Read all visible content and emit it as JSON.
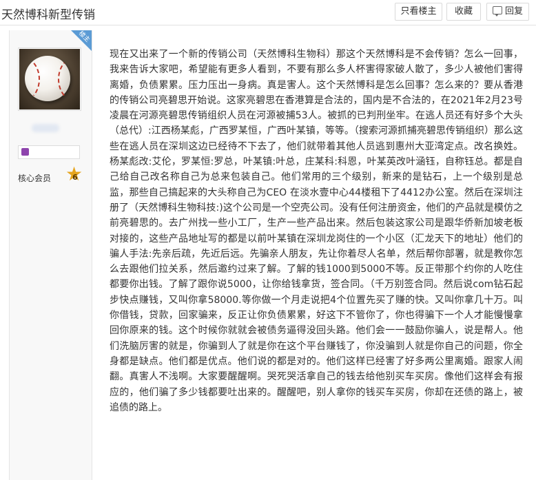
{
  "header": {
    "title": "天然博科新型传销",
    "only_op_label": "只看楼主",
    "favorite_label": "收藏",
    "reply_label": "回复"
  },
  "author": {
    "badge": "楼主",
    "level_label": "核心会员",
    "level_number": "6"
  },
  "post": {
    "content": "现在又出来了一个新的传销公司（天然博科生物科）那这个天然博科是不会传销？怎么一回事，我来告诉大家吧，希望能有更多人看到，不要有那么多人杯害得家破人散了，多少人被他们害得离婚，负债累累。压力压出一身病。真是害人。这个天然博科是怎么回事？怎么来的？要从香港的传销公司亮碧思开始说。这家亮碧思在香港算是合法的，国内是不合法的，在2021年2月23号凌晨在河源亮碧思传销组织人员在河源被捕53人。被抓的已判刑坐牢。在逃人员还有好多个大头（总代）:江西杨某彪，广西罗某恒，广西叶某镇，等等。（搜索河源抓捕亮碧思传销组织）那么这些在逃人员在深圳这边已经待不下去了，他们就带着其他人员逃到惠州大亚湾定点。改名换姓。杨某彪改:艾伦，罗某恒:罗总，叶某镇:叶总，庄某科:科恩，叶某英改叶涵钰，自称钰总。都是自己给自己改名称自己为总来包装自己。他们常用的三个级别，新来的是钻石，上一个级别是总监，那些自己搞起来的大头称自己为CEO 在淡水壹中心44楼租下了4412办公室。然后在深圳注册了（天然博科生物科技:)这个公司是一个空壳公司。没有任何注册资金，他们的产品就是模仿之前亮碧思的。去广州找一些小工厂，生产一些产品出来。然后包装这家公司是跟华侨新加坡老板对接的，这些产品地址写的都是以前叶某镇在深圳龙岗住的一个小区（汇龙天下的地址）他们的骗人手法:先亲后疏，先近后远。先骗亲人朋友，先让你着尽人名单，然后帮你部署，就是教你怎么去跟他们拉关系，然后邀约过来了解。了解的钱1000到5000不等。反正带那个约你的人吃住都要你出钱。了解了跟你说5000，让你给钱拿货，签合同。（千万别签合同。然后说com钻石起步快点赚钱，又叫你拿58000.等你做一个月走说把4个位置先买了赚的快。又叫你拿几十万。叫你借钱，贷款，回家骗来，反正让你负债累累，好这下不管你了，你也得骗下一个人才能慢慢拿回你原来的钱。这个时候你就就会被债务逼得没回头路。他们会一一鼓励你骗人，说是帮人。他们洗脑厉害的就是，你骗到人了就是你在这个平台赚钱了，你没骗到人就是你自己的问题，你全身都是缺点。他们都是优点。他们说的都是对的。他们这样已经害了好多两公里离婚。跟家人闹翻。真害人不浅啊。大家要醒醒啊。哭死哭活拿自己的钱去给他别买车买房。像他们这样会有报应的，他们骗了多少钱都要吐出来的。醒醒吧，别人拿你的钱买车买房，你却在还债的路上，被追债的路上。"
  },
  "icons": [
    "reply-icon",
    "avatar-baseball",
    "level-star-icon"
  ]
}
